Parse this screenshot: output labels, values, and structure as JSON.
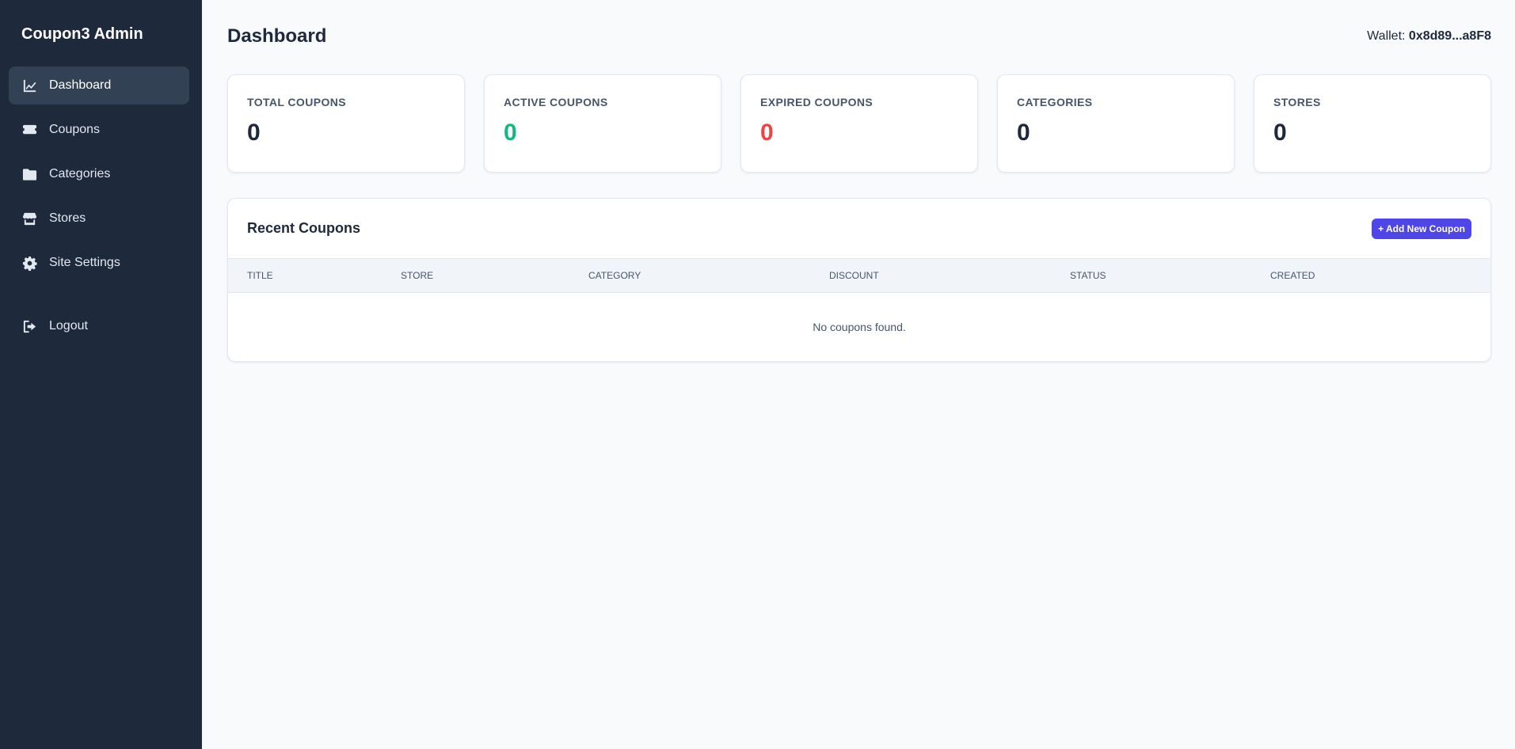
{
  "sidebar": {
    "brand": "Coupon3 Admin",
    "items": [
      {
        "label": "Dashboard",
        "icon": "chart-line-icon",
        "active": true
      },
      {
        "label": "Coupons",
        "icon": "ticket-icon",
        "active": false
      },
      {
        "label": "Categories",
        "icon": "folder-icon",
        "active": false
      },
      {
        "label": "Stores",
        "icon": "store-icon",
        "active": false
      },
      {
        "label": "Site Settings",
        "icon": "gear-icon",
        "active": false
      }
    ],
    "logout": {
      "label": "Logout",
      "icon": "logout-icon"
    }
  },
  "header": {
    "title": "Dashboard",
    "wallet_label": "Wallet:",
    "wallet_address": "0x8d89...a8F8"
  },
  "stats": [
    {
      "label": "TOTAL COUPONS",
      "value": "0",
      "color": "#1e293b"
    },
    {
      "label": "ACTIVE COUPONS",
      "value": "0",
      "color": "#10b981"
    },
    {
      "label": "EXPIRED COUPONS",
      "value": "0",
      "color": "#ef4444"
    },
    {
      "label": "CATEGORIES",
      "value": "0",
      "color": "#1e293b"
    },
    {
      "label": "STORES",
      "value": "0",
      "color": "#1e293b"
    }
  ],
  "recent": {
    "title": "Recent Coupons",
    "add_button": "+ Add New Coupon",
    "columns": [
      "TITLE",
      "STORE",
      "CATEGORY",
      "DISCOUNT",
      "STATUS",
      "CREATED"
    ],
    "empty_text": "No coupons found."
  },
  "colors": {
    "sidebar_bg": "#1e293b",
    "accent": "#4f46e5",
    "success": "#10b981",
    "danger": "#ef4444"
  }
}
